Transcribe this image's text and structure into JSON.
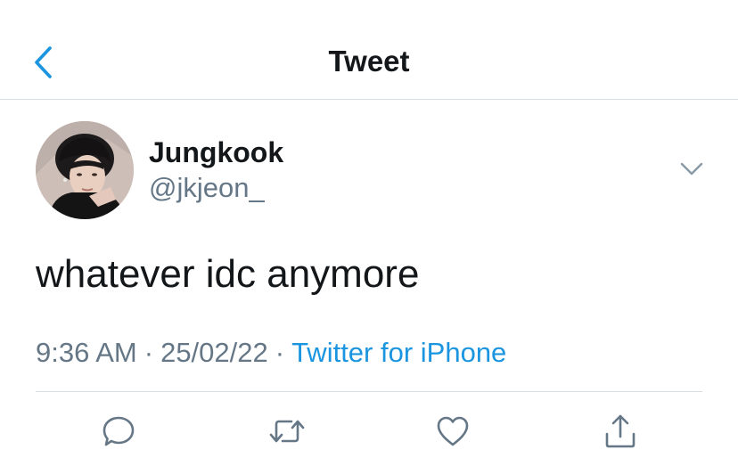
{
  "header": {
    "title": "Tweet",
    "back_icon": "chevron-left-icon"
  },
  "author": {
    "display_name": "Jungkook",
    "handle": "@jkjeon_",
    "avatar": "profile-photo"
  },
  "tweet": {
    "text": "whatever idc anymore",
    "time": "9:36 AM",
    "separator": "·",
    "date": "25/02/22",
    "source": "Twitter for iPhone"
  },
  "actions": {
    "reply_icon": "reply-bubble-icon",
    "retweet_icon": "retweet-icon",
    "like_icon": "heart-icon",
    "share_icon": "share-icon"
  },
  "colors": {
    "accent": "#1b95e0",
    "text": "#14171a",
    "secondary": "#657786",
    "divider": "#d8dde1"
  }
}
